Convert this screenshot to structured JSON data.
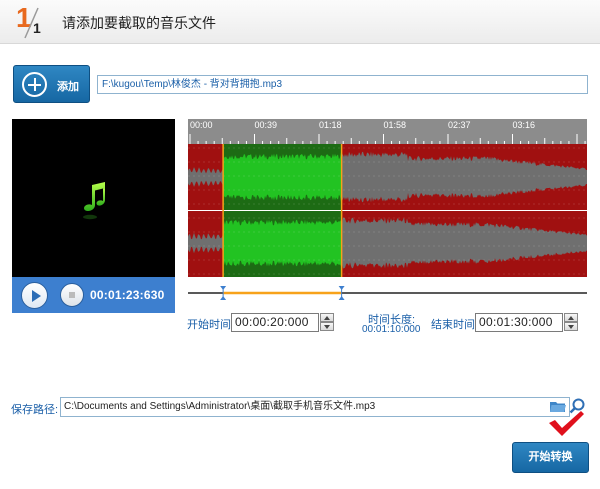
{
  "header": {
    "step_current": "1",
    "step_total": "1",
    "title": "请添加要截取的音乐文件"
  },
  "toolbar": {
    "add_label": "添加",
    "file_path": "F:\\kugou\\Temp\\林俊杰 - 背对背拥抱.mp3"
  },
  "player": {
    "icon": "music-note-icon",
    "time": "00:01:23:630"
  },
  "timeline": {
    "ticks": [
      "00:00",
      "00:39",
      "01:18",
      "01:58",
      "02:37",
      "03:16"
    ]
  },
  "selection": {
    "start_fraction": 0.088,
    "end_fraction": 0.385
  },
  "trim": {
    "start_label": "开始时间:",
    "start_value": "00:00:20:000",
    "duration_label": "时间长度:",
    "duration_value": "00:01:10:000",
    "end_label": "结束时间:",
    "end_value": "00:01:30:000"
  },
  "save": {
    "label": "保存路径:",
    "path": "C:\\Documents and Settings\\Administrator\\桌面\\截取手机音乐文件.mp3"
  },
  "actions": {
    "start_label": "开始转换"
  },
  "colors": {
    "accent_blue": "#1f77b8",
    "wave_bg": "#a01010",
    "wave_selected": "#22c322",
    "wave_unselected": "#6f6f6f",
    "marker_orange": "#f7a21a"
  }
}
